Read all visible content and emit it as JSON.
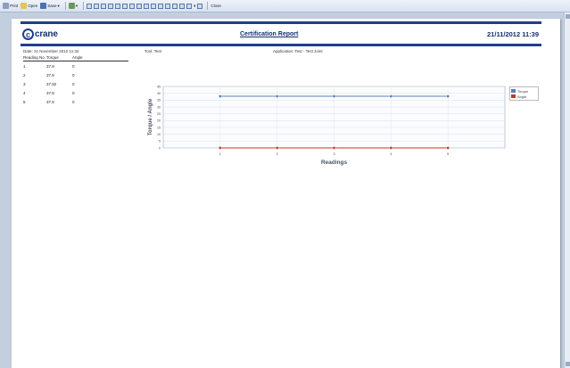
{
  "toolbar": {
    "print_label": "Print",
    "open_label": "Open",
    "save_label": "Save",
    "close_label": "Close"
  },
  "header": {
    "logo_mark": "c",
    "logo_text": "crane",
    "title": "Certification Report",
    "datetime": "21/11/2012  11:39"
  },
  "meta": {
    "date": "Date:  21 November 2012 11:32",
    "tool": "Tool:  Test",
    "application": "Application:  Test - Test Joint"
  },
  "readings_table": {
    "columns": [
      "Reading No.",
      "Torque",
      "Angle"
    ],
    "rows": [
      [
        "1",
        "37.8",
        "0"
      ],
      [
        "2",
        "37.8",
        "0"
      ],
      [
        "3",
        "37.82",
        "0"
      ],
      [
        "4",
        "37.8",
        "0"
      ],
      [
        "5",
        "37.8",
        "0"
      ]
    ]
  },
  "chart_data": {
    "type": "line",
    "xlabel": "Readings",
    "ylabel": "Torque / Angle",
    "x": [
      1,
      2,
      3,
      4,
      5
    ],
    "ylim": [
      0,
      45
    ],
    "yticks": [
      0,
      5,
      10,
      15,
      20,
      25,
      30,
      35,
      40,
      45
    ],
    "series": [
      {
        "name": "Torque",
        "values": [
          37.8,
          37.8,
          37.82,
          37.8,
          37.8
        ],
        "color": "#5b7fb8"
      },
      {
        "name": "Angle",
        "values": [
          0,
          0,
          0,
          0,
          0
        ],
        "color": "#c0392b"
      }
    ],
    "legend": "right",
    "grid": true
  },
  "colors": {
    "brand": "#1e3f8a"
  }
}
